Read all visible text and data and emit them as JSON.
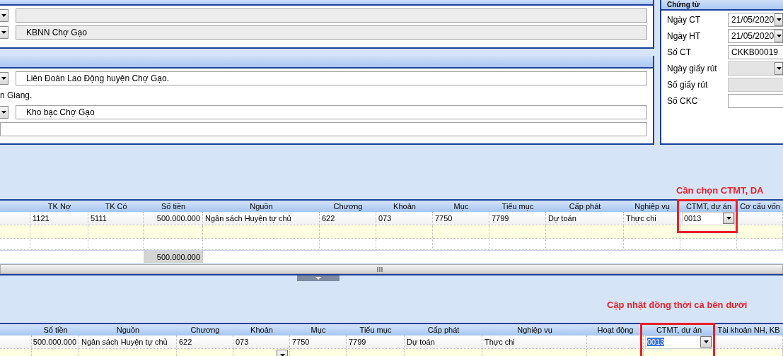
{
  "entity_panel": {
    "fields": [
      {
        "kind": "dropdown",
        "disabled": true
      },
      {
        "kind": "dropdown",
        "value": "KBNN Chợ Gạo",
        "disabled": true
      }
    ]
  },
  "payee_panel": {
    "fields": [
      {
        "kind": "dropdown",
        "value": "Liên Đoàn Lao Động huyện Chợ Gạo.",
        "disabled": false
      },
      {
        "kind": "text",
        "value": "n Giang."
      },
      {
        "kind": "dropdown",
        "value": "Kho bạc Chợ Gạo",
        "disabled": false
      },
      {
        "kind": "input",
        "disabled": false
      }
    ]
  },
  "voucher_panel": {
    "title": "Chứng từ",
    "fields": [
      {
        "label": "Ngày CT",
        "kind": "date",
        "value": "21/05/2020",
        "disabled": false
      },
      {
        "label": "Ngày HT",
        "kind": "date",
        "value": "21/05/2020",
        "disabled": false
      },
      {
        "label": "Số CT",
        "kind": "input",
        "value": "CKKB00019",
        "disabled": false
      },
      {
        "label": "Ngày giấy rút",
        "kind": "date",
        "disabled": true
      },
      {
        "label": "Số giấy rút",
        "kind": "input",
        "disabled": true
      },
      {
        "label": "Số CKC",
        "kind": "input",
        "disabled": false
      }
    ]
  },
  "grid_1": {
    "note": "Cần chọn CTMT, DA",
    "columns": [
      {
        "highlighted": false
      },
      {
        "label": "TK Nợ",
        "highlighted": false
      },
      {
        "label": "TK Có",
        "highlighted": false
      },
      {
        "label": "Số tiền",
        "highlighted": false
      },
      {
        "label": "Nguồn",
        "highlighted": false
      },
      {
        "label": "Chương",
        "highlighted": false
      },
      {
        "label": "Khoản",
        "highlighted": false
      },
      {
        "label": "Mục",
        "highlighted": false
      },
      {
        "label": "Tiểu mục",
        "highlighted": false
      },
      {
        "label": "Cấp phát",
        "highlighted": false
      },
      {
        "label": "Nghiệp vụ",
        "highlighted": false
      },
      {
        "label": "CTMT, dự án",
        "highlighted": true
      },
      {
        "label": "Cơ cấu vốn",
        "highlighted": false
      }
    ],
    "rows": [
      {
        "kind": "data",
        "cells": [
          null,
          "1121",
          "5111",
          "500.000.000",
          "Ngân sách Huyện tự chủ",
          "622",
          "073",
          "7750",
          "7799",
          "Dự toán",
          "Thực chi",
          {
            "kind": "combo",
            "text": "0013",
            "selected": false
          },
          null
        ]
      },
      {
        "kind": "new"
      },
      {
        "kind": "blank"
      }
    ],
    "total": "500.000.000"
  },
  "grid_2": {
    "note": "Cập nhật đồng thời cả bên dưới",
    "columns": [
      {
        "highlighted": false
      },
      {
        "label": "Số tiền",
        "highlighted": false
      },
      {
        "label": "Nguồn",
        "highlighted": false
      },
      {
        "label": "Chương",
        "highlighted": false
      },
      {
        "label": "Khoản",
        "highlighted": false
      },
      {
        "label": "Mục",
        "highlighted": false
      },
      {
        "label": "Tiểu mục",
        "highlighted": false
      },
      {
        "label": "Cấp phát",
        "highlighted": false
      },
      {
        "label": "Nghiệp vụ",
        "highlighted": false
      },
      {
        "label": "Hoạt động",
        "highlighted": false
      },
      {
        "label": "CTMT, dự án",
        "highlighted": true
      },
      {
        "label": "Tài khoản NH, KB",
        "highlighted": false
      }
    ],
    "rows": [
      {
        "kind": "data",
        "cells": [
          null,
          "500.000.000",
          "Ngân sách Huyện tự chủ",
          "622",
          "073",
          "7750",
          "7799",
          "Dự toán",
          "Thực chi",
          null,
          {
            "kind": "combo",
            "text": "0013",
            "selected": true
          },
          null
        ]
      },
      {
        "kind": "new",
        "cells": [
          null,
          null,
          null,
          null,
          {
            "kind": "combo"
          }
        ]
      }
    ]
  }
}
